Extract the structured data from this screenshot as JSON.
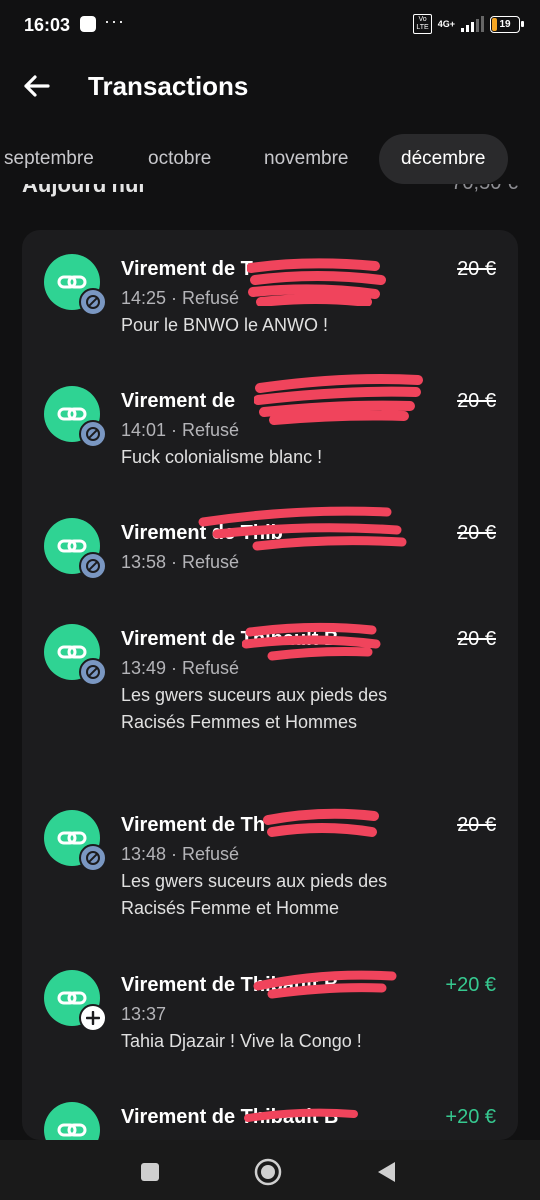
{
  "status_bar": {
    "time": "16:03",
    "network_label": "4G+",
    "volte_label": "Vo LTE",
    "battery": "19"
  },
  "header": {
    "title": "Transactions"
  },
  "tabs": [
    {
      "label": "septembre",
      "active": false
    },
    {
      "label": "octobre",
      "active": false
    },
    {
      "label": "novembre",
      "active": false
    },
    {
      "label": "décembre",
      "active": true
    }
  ],
  "section": {
    "label": "Aujourd'hui",
    "total": "70,50 €"
  },
  "transactions": [
    {
      "name": "Virement de T",
      "meta": "14:25 · Refusé",
      "note": "Pour le BNWO le ANWO !",
      "amount": "20 €",
      "status": "refused"
    },
    {
      "name": "Virement de",
      "meta": "14:01 · Refusé",
      "note": "Fuck colonialisme blanc !",
      "amount": "20 €",
      "status": "refused"
    },
    {
      "name": "Virement de Thib",
      "meta": "13:58 · Refusé",
      "note": "",
      "amount": "20 €",
      "status": "refused"
    },
    {
      "name": "Virement de Thibault B",
      "meta": "13:49 · Refusé",
      "note": "Les gwers suceurs aux pieds des Racisés Femmes et Hommes",
      "amount": "20 €",
      "status": "refused"
    },
    {
      "name": "Virement de Th",
      "meta": "13:48 · Refusé",
      "note": "Les gwers suceurs aux pieds des Racisés Femme et Homme",
      "amount": "20 €",
      "status": "refused"
    },
    {
      "name": "Virement de Thibault B",
      "meta": "13:37",
      "note": "Tahia Djazair ! Vive la Congo !",
      "amount": "+20 €",
      "status": "received"
    },
    {
      "name": "Virement de Thibault B",
      "meta": "",
      "note": "",
      "amount": "+20 €",
      "status": "received"
    }
  ],
  "colors": {
    "avatar": "#2fd393",
    "positive": "#36c990",
    "refused_badge": "#7a97c2",
    "redaction": "#f0445c"
  },
  "icons": {
    "back": "arrow-left-icon",
    "avatar": "link-icon",
    "refused": "blocked-icon",
    "received": "plus-icon"
  }
}
